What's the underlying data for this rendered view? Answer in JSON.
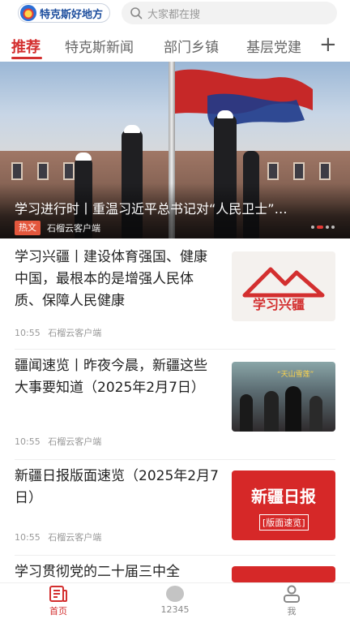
{
  "header": {
    "app_name": "特克斯好地方",
    "search_placeholder": "大家都在搜"
  },
  "tabs": [
    {
      "label": "推荐",
      "active": true
    },
    {
      "label": "特克斯新闻",
      "active": false
    },
    {
      "label": "部门乡镇",
      "active": false
    },
    {
      "label": "基层党建",
      "active": false
    }
  ],
  "banner": {
    "title": "学习进行时丨重温习近平总书记对“人民卫士”…",
    "badge": "热文",
    "source": "石榴云客户端"
  },
  "news": [
    {
      "title": "学习兴疆丨建设体育强国、健康中国，最根本的是增强人民体质、保障人民健康",
      "time": "10:55",
      "source": "石榴云客户端",
      "thumb_text": "学习兴疆"
    },
    {
      "title": "疆闻速览丨昨夜今晨，新疆这些大事要知道（2025年2月7日）",
      "time": "10:55",
      "source": "石榴云客户端",
      "thumb_text": "“天山雪莲”"
    },
    {
      "title": "新疆日报版面速览（2025年2月7日）",
      "time": "10:55",
      "source": "石榴云客户端",
      "thumb_text": "新疆日报",
      "thumb_sub": "[版面速览]"
    },
    {
      "title": "学习贯彻党的二十届三中全",
      "time": "",
      "source": ""
    }
  ],
  "bottom_nav": [
    {
      "label": "首页",
      "icon": "news-icon",
      "active": true
    },
    {
      "label": "12345",
      "icon": "circle-icon",
      "active": false
    },
    {
      "label": "我",
      "icon": "user-icon",
      "active": false
    }
  ],
  "colors": {
    "accent": "#d32f2f",
    "brand": "#1d4e9e"
  }
}
